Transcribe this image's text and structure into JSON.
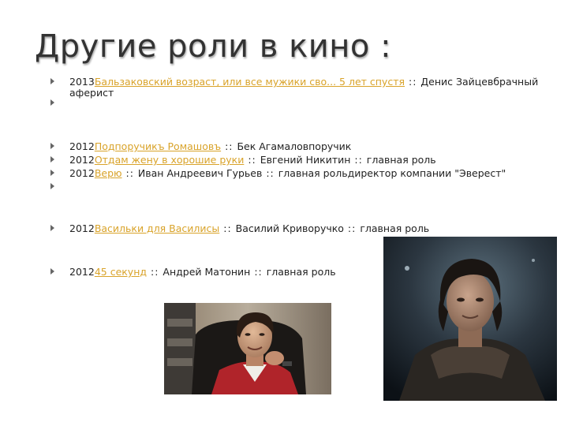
{
  "title": "Другие роли в кино :",
  "roles": [
    {
      "year": "2013",
      "film": "Бальзаковский возраст, или все мужики сво... 5 лет спустя",
      "sep1": " :: ",
      "role": "Денис Зайцевбрачный",
      "wrap": "аферист"
    },
    {
      "year": "2012",
      "film": "Подпоручикъ Ромашовъ",
      "sep1": " :: ",
      "role": "Бек Агамаловпоручик"
    },
    {
      "year": "2012",
      "film": "Отдам жену в хорошие руки",
      "sep1": " :: ",
      "role": "Евгений Никитин",
      "sep2": " :: ",
      "note": "главная роль"
    },
    {
      "year": "2012",
      "film": "Верю",
      "sep1": " :: ",
      "role": "Иван Андреевич Гурьев",
      "sep2": " :: ",
      "note": "главная рольдиректор компании \"Эверест\""
    },
    {
      "year": "2012",
      "film": "Васильки для Василисы",
      "sep1": " :: ",
      "role": "Василий Криворучко",
      "sep2": " :: ",
      "note": "главная роль"
    },
    {
      "year": "2012",
      "film": "45 секунд",
      "sep1": " :: ",
      "role": "Андрей Матонин",
      "sep2": " :: ",
      "note": "главная роль"
    }
  ],
  "colors": {
    "link": "#d9a32a",
    "bullet": "#666666",
    "title": "#333333"
  }
}
